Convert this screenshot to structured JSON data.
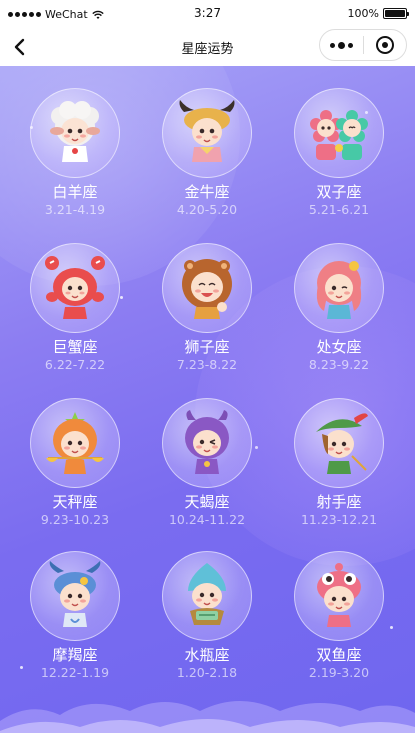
{
  "status_bar": {
    "carrier": "WeChat",
    "time": "3:27",
    "battery": "100%"
  },
  "navbar": {
    "title": "星座运势",
    "icons": {
      "back": "chevron-left-icon",
      "more": "more-dots-icon",
      "close": "target-close-icon"
    }
  },
  "signs": [
    {
      "name": "白羊座",
      "range": "3.21-4.19",
      "icon": "aries-character"
    },
    {
      "name": "金牛座",
      "range": "4.20-5.20",
      "icon": "taurus-character"
    },
    {
      "name": "双子座",
      "range": "5.21-6.21",
      "icon": "gemini-character"
    },
    {
      "name": "巨蟹座",
      "range": "6.22-7.22",
      "icon": "cancer-character"
    },
    {
      "name": "狮子座",
      "range": "7.23-8.22",
      "icon": "leo-character"
    },
    {
      "name": "处女座",
      "range": "8.23-9.22",
      "icon": "virgo-character"
    },
    {
      "name": "天秤座",
      "range": "9.23-10.23",
      "icon": "libra-character"
    },
    {
      "name": "天蝎座",
      "range": "10.24-11.22",
      "icon": "scorpio-character"
    },
    {
      "name": "射手座",
      "range": "11.23-12.21",
      "icon": "sagittarius-character"
    },
    {
      "name": "摩羯座",
      "range": "12.22-1.19",
      "icon": "capricorn-character"
    },
    {
      "name": "水瓶座",
      "range": "1.20-2.18",
      "icon": "aquarius-character"
    },
    {
      "name": "双鱼座",
      "range": "2.19-3.20",
      "icon": "pisces-character"
    }
  ],
  "colors": {
    "background_top": "#a7a3f7",
    "background_bottom": "#6f66ef",
    "sign_name": "#ffffff",
    "date_range": "#c9c2f6"
  }
}
